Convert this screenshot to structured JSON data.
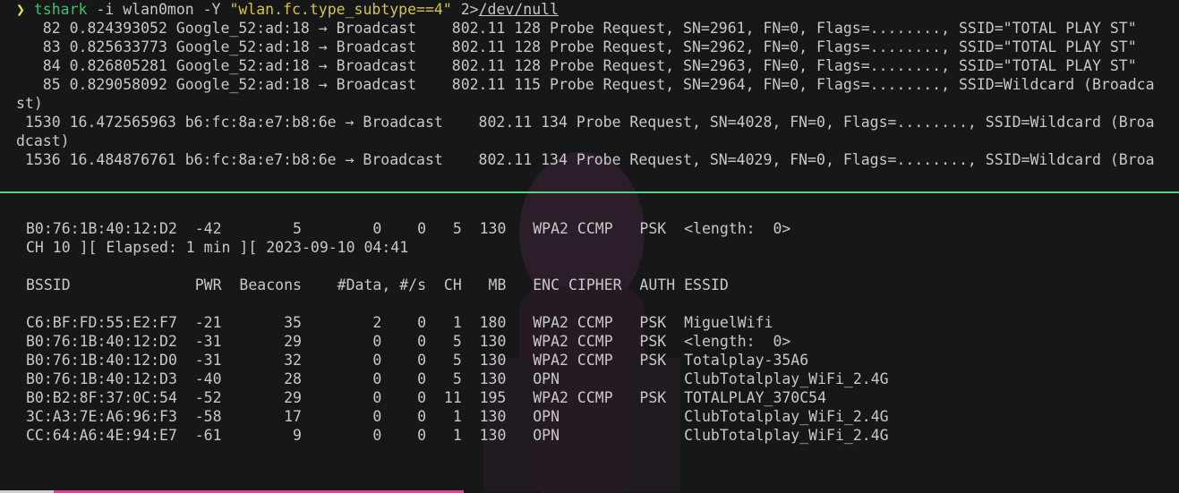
{
  "colors": {
    "background": "#161718",
    "text": "#c8c8c8",
    "prompt_arrow": "#e8e84a",
    "command": "#3fbf6a",
    "string_arg": "#d8c24a",
    "divider": "#5ed07a",
    "bottom_bar": "#d8478f"
  },
  "icons": {
    "prompt": "chevron-right-icon"
  },
  "command_line": {
    "prompt_symbol": "❯",
    "command": "tshark",
    "args": " -i wlan0mon -Y ",
    "filter": "\"wlan.fc.type_subtype==4\"",
    "redirect": " 2>",
    "target": "/dev/null"
  },
  "tshark_output": [
    "   82 0.824393052 Google_52:ad:18 → Broadcast    802.11 128 Probe Request, SN=2961, FN=0, Flags=........, SSID=\"TOTAL PLAY ST\"",
    "   83 0.825633773 Google_52:ad:18 → Broadcast    802.11 128 Probe Request, SN=2962, FN=0, Flags=........, SSID=\"TOTAL PLAY ST\"",
    "   84 0.826805281 Google_52:ad:18 → Broadcast    802.11 128 Probe Request, SN=2963, FN=0, Flags=........, SSID=\"TOTAL PLAY ST\"",
    "   85 0.829058092 Google_52:ad:18 → Broadcast    802.11 115 Probe Request, SN=2964, FN=0, Flags=........, SSID=Wildcard (Broadca",
    "st)",
    " 1530 16.472565963 b6:fc:8a:e7:b8:6e → Broadcast    802.11 134 Probe Request, SN=4028, FN=0, Flags=........, SSID=Wildcard (Broa",
    "dcast)",
    " 1536 16.484876761 b6:fc:8a:e7:b8:6e → Broadcast    802.11 134 Probe Request, SN=4029, FN=0, Flags=........, SSID=Wildcard (Broa"
  ],
  "airodump": {
    "top_row": "B0:76:1B:40:12:D2  -42        5        0    0   5  130   WPA2 CCMP   PSK  <length:  0>",
    "status": "CH 10 ][ Elapsed: 1 min ][ 2023-09-10 04:41",
    "header": "BSSID              PWR  Beacons    #Data, #/s  CH   MB   ENC CIPHER  AUTH ESSID",
    "rows": [
      "C6:BF:FD:55:E2:F7  -21       35        2    0   1  180   WPA2 CCMP   PSK  MiguelWifi",
      "B0:76:1B:40:12:D2  -31       29        0    0   5  130   WPA2 CCMP   PSK  <length:  0>",
      "B0:76:1B:40:12:D0  -31       32        0    0   5  130   WPA2 CCMP   PSK  Totalplay-35A6",
      "B0:76:1B:40:12:D3  -40       28        0    0   5  130   OPN              ClubTotalplay_WiFi_2.4G",
      "B0:B2:8F:37:0C:54  -52       29        0    0  11  195   WPA2 CCMP   PSK  TOTALPLAY_370C54",
      "3C:A3:7E:A6:96:F3  -58       17        0    0   1  130   OPN              ClubTotalplay_WiFi_2.4G",
      "CC:64:A6:4E:94:E7  -61        9        0    0   1  130   OPN              ClubTotalplay_WiFi_2.4G"
    ]
  }
}
